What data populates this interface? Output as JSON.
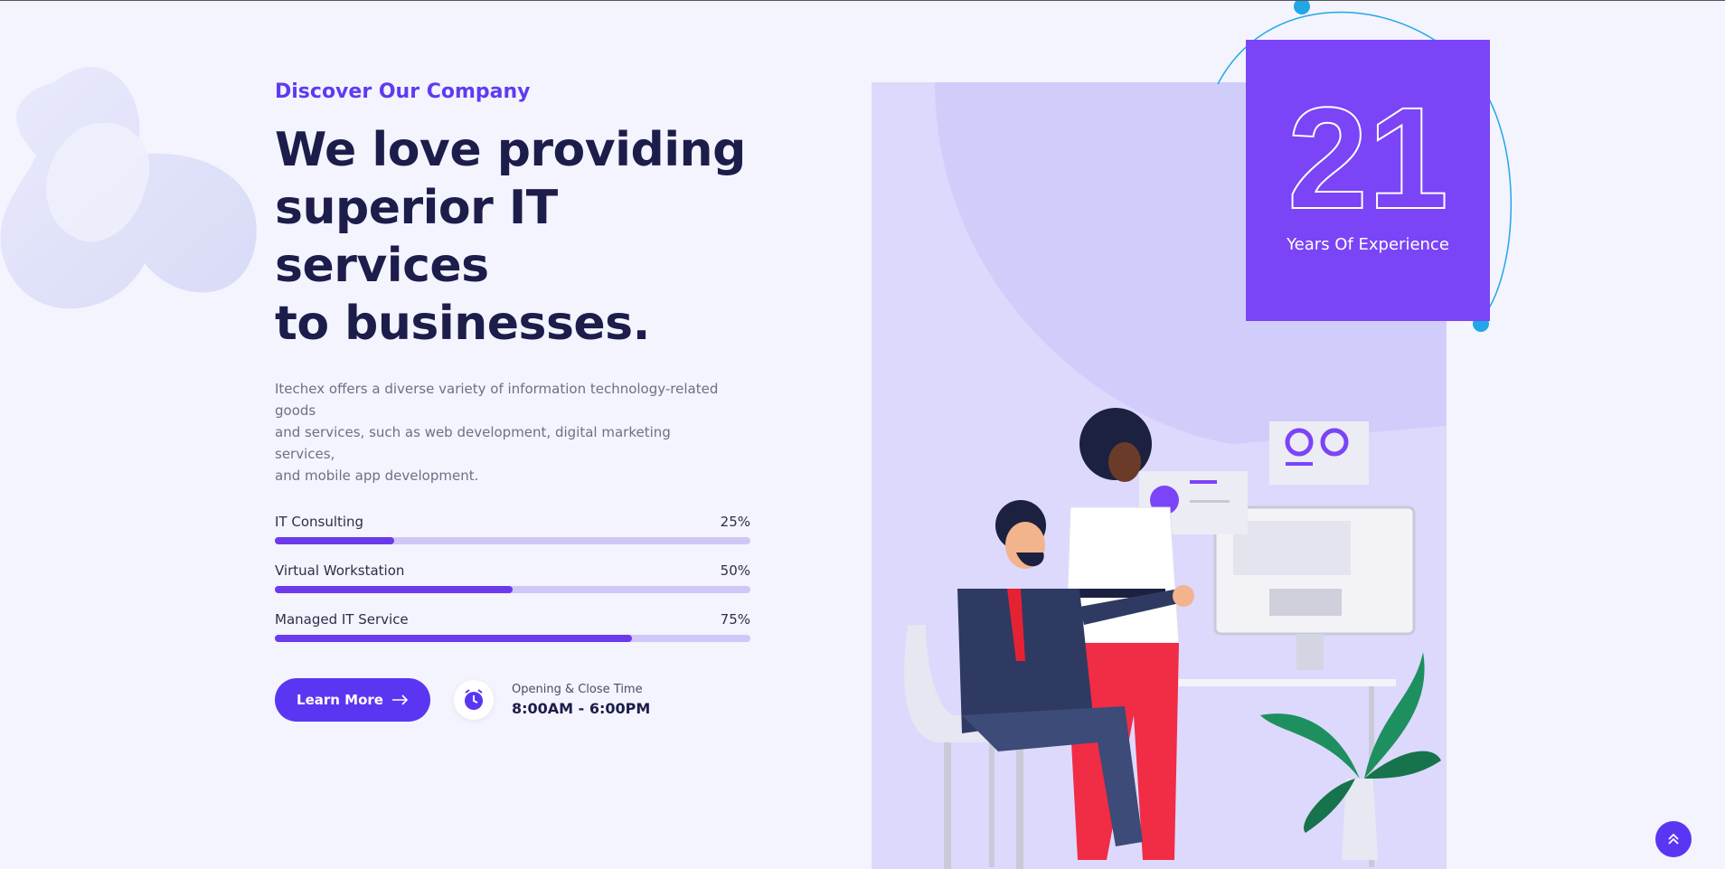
{
  "about": {
    "eyebrow": "Discover Our Company",
    "title_lines": [
      "We love providing",
      "superior IT services",
      "to businesses."
    ],
    "description_lines": [
      "Itechex offers a diverse variety of information technology-related goods",
      "and services, such as web development, digital marketing services,",
      "and mobile app development."
    ]
  },
  "skills": [
    {
      "label": "IT Consulting",
      "percent_text": "25%",
      "value": 0.25
    },
    {
      "label": "Virtual Workstation",
      "percent_text": "50%",
      "value": 0.5
    },
    {
      "label": "Managed IT Service",
      "percent_text": "75%",
      "value": 0.75
    }
  ],
  "cta": {
    "learn_more_label": "Learn More",
    "arrow_icon": "arrow-right-icon"
  },
  "hours": {
    "label": "Opening & Close Time",
    "value": "8:00AM - 6:00PM",
    "icon": "clock-icon"
  },
  "experience": {
    "number": "21",
    "label": "Years Of Experience"
  },
  "colors": {
    "accent": "#5b36f2",
    "badge": "#7b44f6",
    "heading": "#1c1d4a",
    "bar_track": "#cfc7f7",
    "bar_fill": "#6c3aea",
    "orbit": "#21a7e8"
  },
  "scroll_top": {
    "icon": "double-chevron-up-icon"
  }
}
